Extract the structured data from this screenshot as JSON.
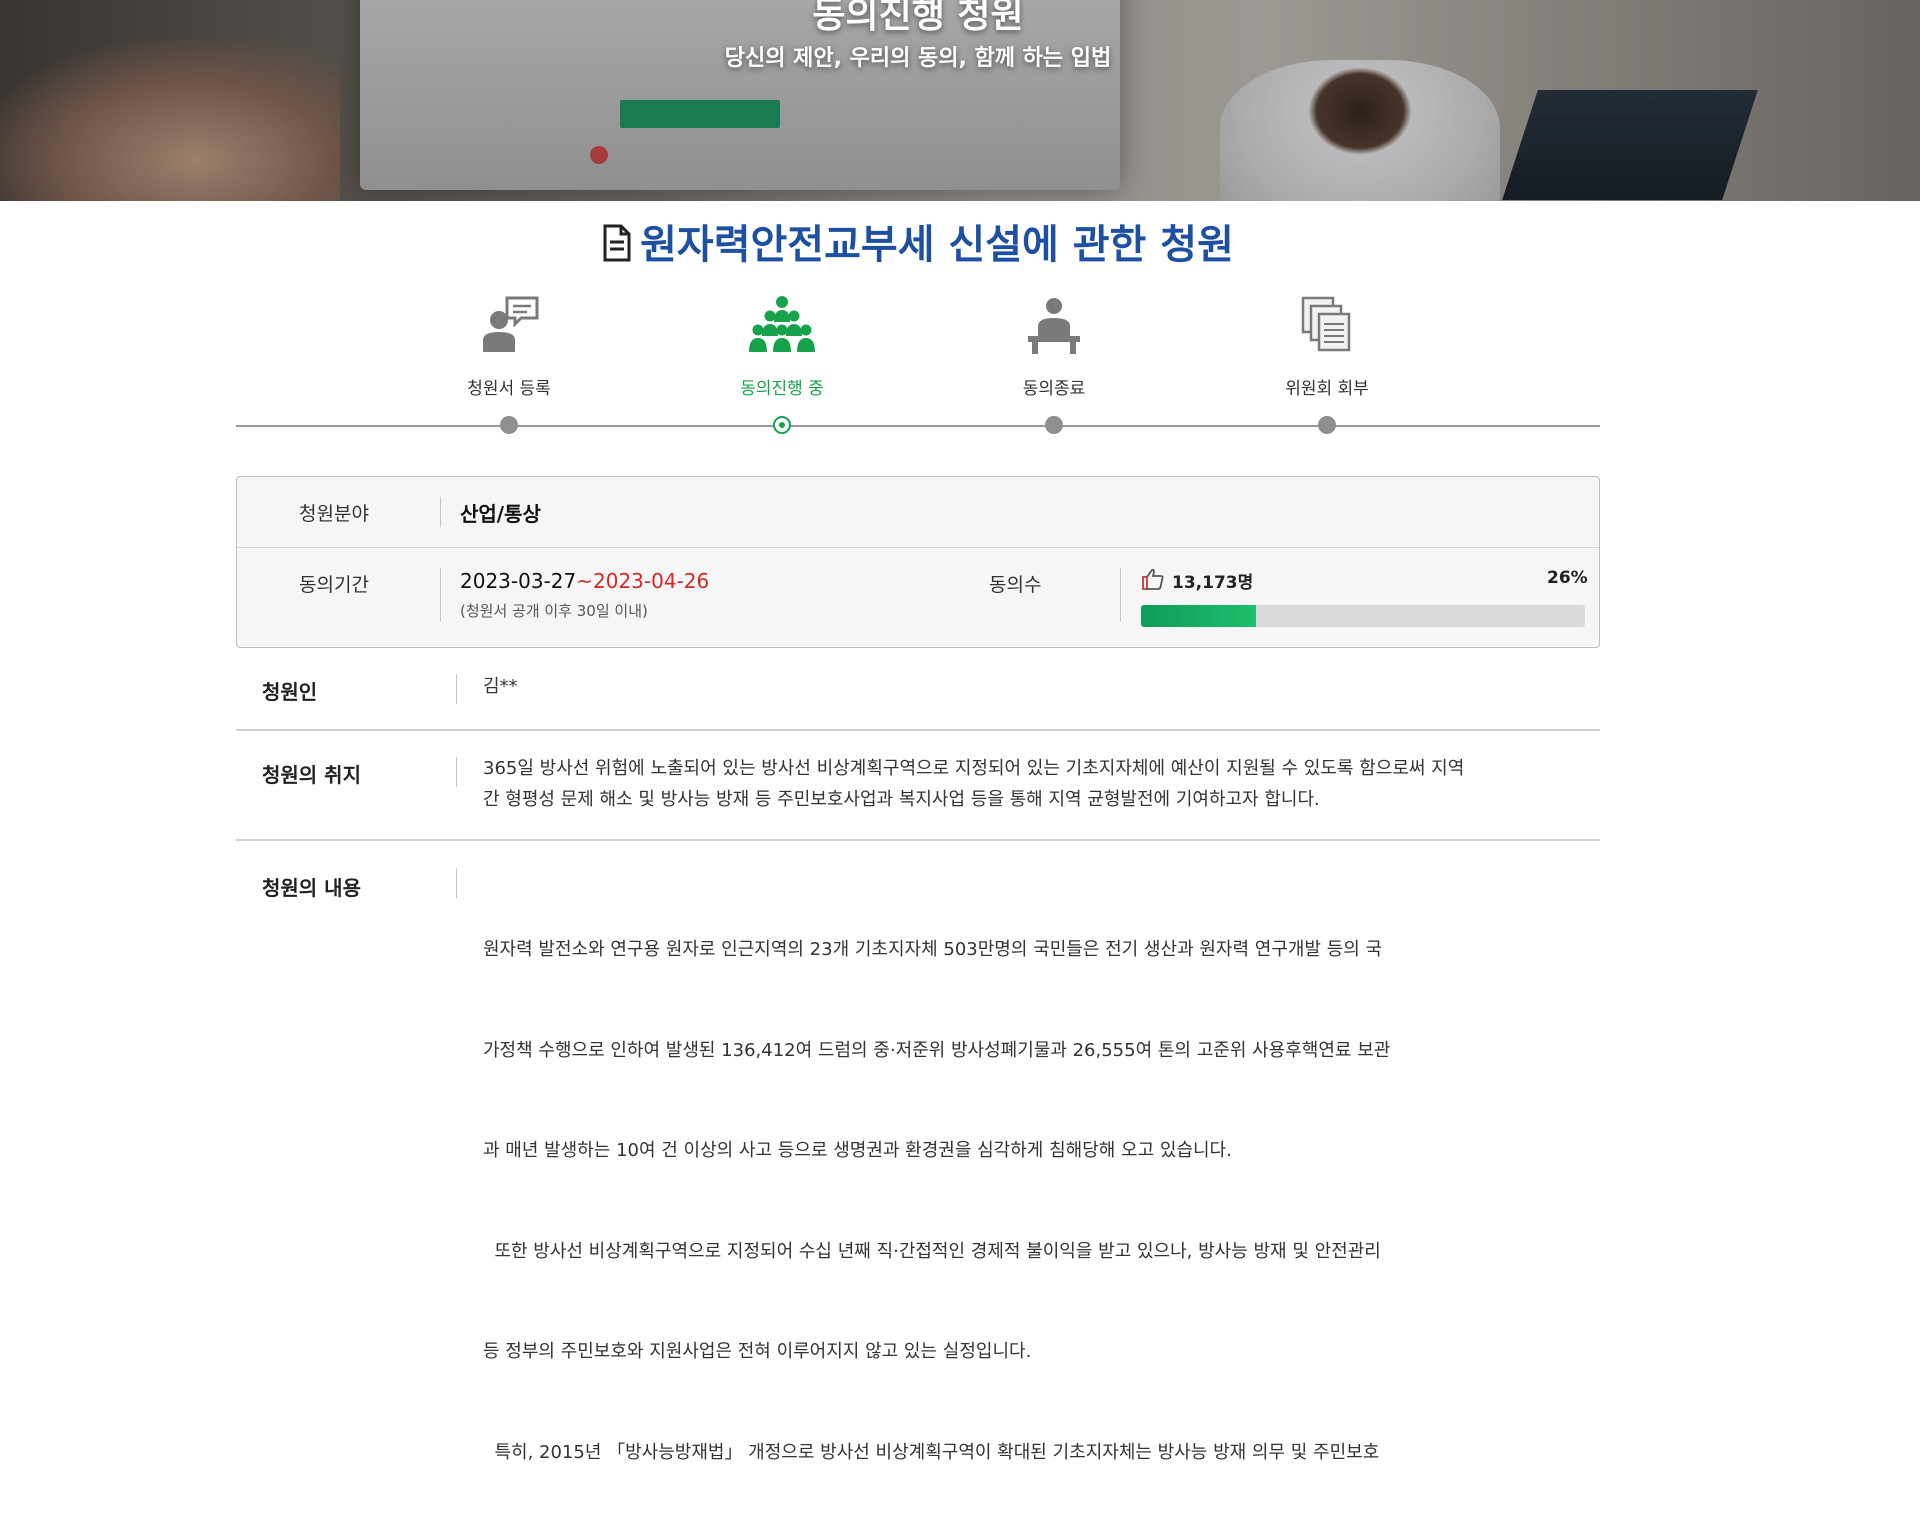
{
  "hero": {
    "title": "동의진행 청원",
    "subtitle": "당신의 제안, 우리의 동의, 함께 하는 입법"
  },
  "petition": {
    "title": "원자력안전교부세 신설에 관한 청원"
  },
  "steps": [
    {
      "label": "청원서 등록",
      "icon": "speech-person-icon",
      "active": false
    },
    {
      "label": "동의진행 중",
      "icon": "people-group-icon",
      "active": true
    },
    {
      "label": "동의종료",
      "icon": "person-desk-icon",
      "active": false
    },
    {
      "label": "위원회 회부",
      "icon": "document-stack-icon",
      "active": false
    }
  ],
  "info": {
    "field_label": "청원분야",
    "field_value": "산업/통상",
    "period_label": "동의기간",
    "period_start": "2023-03-27",
    "period_tilde": "~",
    "period_end": "2023-04-26",
    "period_note": "(청원서 공개 이후 30일 이내)",
    "count_label": "동의수",
    "count_value": "13,173명",
    "count_percent_text": "26%",
    "count_progress": 0.26
  },
  "details": {
    "petitioner_label": "청원인",
    "petitioner_value": "김**",
    "purpose_label": "청원의 취지",
    "purpose_lines": [
      "365일 방사선 위험에 노출되어 있는 방사선 비상계획구역으로 지정되어 있는 기초지자체에 예산이 지원될 수 있도록 함으로써 지역",
      "간 형평성 문제 해소 및 방사능 방재 등 주민보호사업과 복지사업 등을 통해 지역 균형발전에 기여하고자 합니다."
    ],
    "content_label": "청원의 내용",
    "content_lines": [
      "원자력 발전소와 연구용 원자로 인근지역의 23개 기초지자체 503만명의 국민들은 전기 생산과 원자력 연구개발 등의 국",
      "가정책 수행으로 인하여 발생된 136,412여 드럼의 중·저준위 방사성폐기물과 26,555여 톤의 고준위 사용후핵연료 보관",
      "과 매년 발생하는 10여 건 이상의 사고 등으로 생명권과 환경권을 심각하게 침해당해 오고 있습니다.",
      "  또한 방사선 비상계획구역으로 지정되어 수십 년째 직·간접적인 경제적 불이익을 받고 있으나, 방사능 방재 및 안전관리",
      "등 정부의 주민보호와 지원사업은 전혀 이루어지지 않고 있는 실정입니다.",
      "  특히, 2015년 「방사능방재법」 개정으로 방사선 비상계획구역이 확대된 기초지자체는 방사능 방재 의무 및 주민보호"
    ]
  },
  "colors": {
    "title_blue": "#1d4fa3",
    "active_green": "#16a34a",
    "end_date_red": "#d62626",
    "progress_green": "#0f9b5c"
  }
}
